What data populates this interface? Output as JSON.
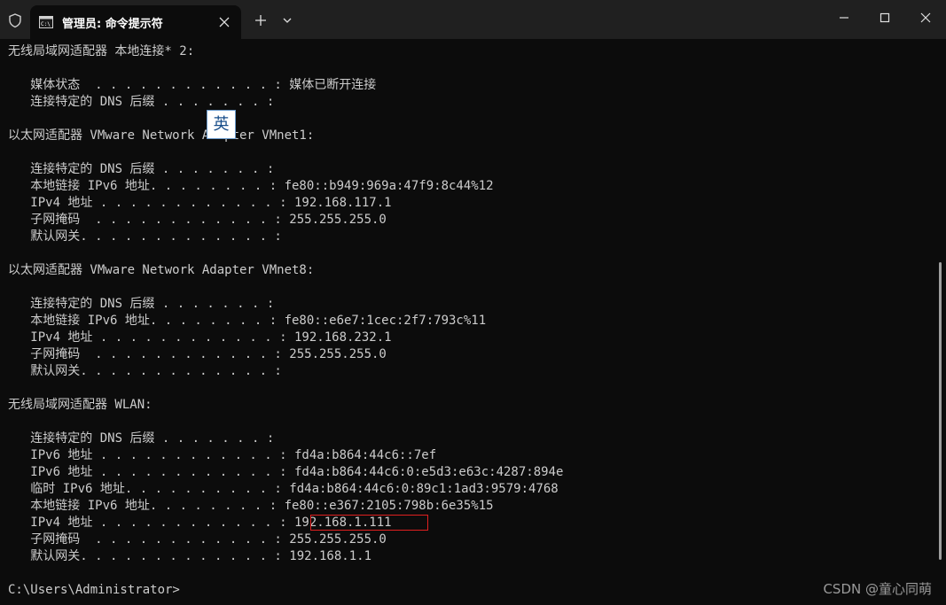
{
  "window": {
    "tab_title": "管理员: 命令提示符"
  },
  "console_lines": [
    "无线局域网适配器 本地连接* 2:",
    "",
    "   媒体状态  . . . . . . . . . . . . : 媒体已断开连接",
    "   连接特定的 DNS 后缀 . . . . . . . :",
    "",
    "以太网适配器 VMware Network Adapter VMnet1:",
    "",
    "   连接特定的 DNS 后缀 . . . . . . . :",
    "   本地链接 IPv6 地址. . . . . . . . : fe80::b949:969a:47f9:8c44%12",
    "   IPv4 地址 . . . . . . . . . . . . : 192.168.117.1",
    "   子网掩码  . . . . . . . . . . . . : 255.255.255.0",
    "   默认网关. . . . . . . . . . . . . :",
    "",
    "以太网适配器 VMware Network Adapter VMnet8:",
    "",
    "   连接特定的 DNS 后缀 . . . . . . . :",
    "   本地链接 IPv6 地址. . . . . . . . : fe80::e6e7:1cec:2f7:793c%11",
    "   IPv4 地址 . . . . . . . . . . . . : 192.168.232.1",
    "   子网掩码  . . . . . . . . . . . . : 255.255.255.0",
    "   默认网关. . . . . . . . . . . . . :",
    "",
    "无线局域网适配器 WLAN:",
    "",
    "   连接特定的 DNS 后缀 . . . . . . . :",
    "   IPv6 地址 . . . . . . . . . . . . : fd4a:b864:44c6::7ef",
    "   IPv6 地址 . . . . . . . . . . . . : fd4a:b864:44c6:0:e5d3:e63c:4287:894e",
    "   临时 IPv6 地址. . . . . . . . . . : fd4a:b864:44c6:0:89c1:1ad3:9579:4768",
    "   本地链接 IPv6 地址. . . . . . . . : fe80::e367:2105:798b:6e35%15",
    "   IPv4 地址 . . . . . . . . . . . . : 192.168.1.111",
    "   子网掩码  . . . . . . . . . . . . : 255.255.255.0",
    "   默认网关. . . . . . . . . . . . . : 192.168.1.1",
    "",
    "C:\\Users\\Administrator>"
  ],
  "ime_indicator": "英",
  "watermark": "CSDN @童心同萌",
  "colors": {
    "console_bg": "#0c0c0c",
    "console_text": "#cccccc",
    "titlebar_bg": "#202020",
    "highlight_border": "#e02020"
  }
}
